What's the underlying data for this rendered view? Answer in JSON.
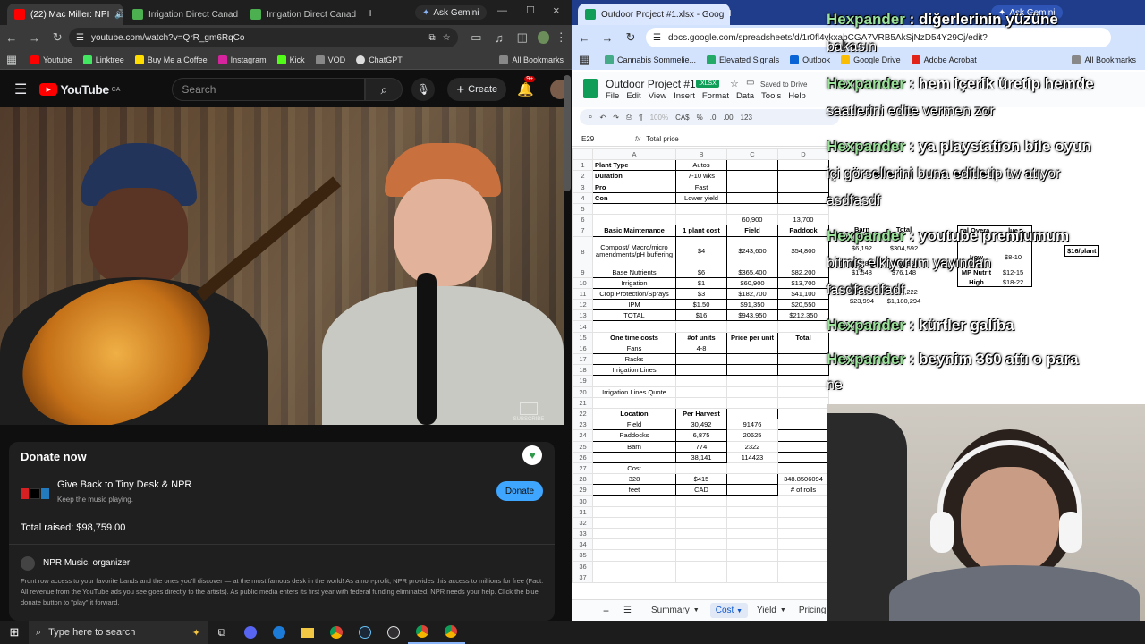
{
  "left_browser": {
    "tabs": [
      {
        "label": "(22) Mac Miller: NPI",
        "active": true
      },
      {
        "label": "Irrigation Direct Canad"
      },
      {
        "label": "Irrigation Direct Canad"
      }
    ],
    "new_tab": "+",
    "ask_gemini": "Ask Gemini",
    "url": "youtube.com/watch?v=QrR_gm6RqCo",
    "bookmarks": [
      "Youtube",
      "Linktree",
      "Buy Me a Coffee",
      "Instagram",
      "Kick",
      "VOD",
      "ChatGPT"
    ],
    "all_bookmarks": "All Bookmarks"
  },
  "youtube": {
    "logo": "YouTube",
    "country": "CA",
    "search_placeholder": "Search",
    "create": "Create",
    "notif_badge": "9+",
    "subscribe_watermark": "SUBSCRIBE",
    "donate": {
      "title": "Donate now",
      "give_back": "Give Back to Tiny Desk & NPR",
      "keep": "Keep the music playing.",
      "donate_btn": "Donate",
      "total": "Total raised: $98,759.00",
      "organizer": "NPR Music, organizer",
      "npr_logo": "n p r",
      "desc": "Front row access to your favorite bands and the ones you'll discover — at the most famous desk in the world! As a non-profit, NPR provides this access to millions for free (Fact: All revenue from the YouTube ads you see goes directly to the artists). As public media enters its first year with federal funding eliminated, NPR needs your help. Click the blue donate button to \"play\" it forward."
    }
  },
  "right_browser": {
    "tab": "Outdoor Project #1.xlsx - Goog",
    "ask_gemini": "Ask Gemini",
    "url": "docs.google.com/spreadsheets/d/1r0fl4vkxabCGA7VRB5AkSjNzD54Y29Cj/edit?",
    "bookmarks": [
      "Cannabis Sommelie...",
      "Elevated Signals",
      "Outlook",
      "Google Drive",
      "Adobe Acrobat"
    ],
    "all_bookmarks": "All Bookmarks"
  },
  "sheets": {
    "title": "Outdoor Project #1",
    "badge": ".XLSX",
    "saved": "Saved to Drive",
    "menu": [
      "File",
      "Edit",
      "View",
      "Insert",
      "Format",
      "Data",
      "Tools",
      "Help"
    ],
    "zoom": "100%",
    "currency": "CA$",
    "percent": "%",
    "dec1": ".0",
    "dec2": ".00",
    "num": "123",
    "cell_ref": "E29",
    "formula": "Total price",
    "columns": [
      "A",
      "B",
      "C",
      "D"
    ],
    "rows": [
      {
        "n": "1",
        "a": "Plant Type",
        "b": "Autos",
        "c": "",
        "d": ""
      },
      {
        "n": "2",
        "a": "Duration",
        "b": "7-10 wks",
        "c": "",
        "d": ""
      },
      {
        "n": "3",
        "a": "Pro",
        "b": "Fast",
        "c": "",
        "d": ""
      },
      {
        "n": "4",
        "a": "Con",
        "b": "Lower yield",
        "c": "",
        "d": ""
      },
      {
        "n": "5",
        "a": "",
        "b": "",
        "c": "",
        "d": ""
      },
      {
        "n": "6",
        "a": "",
        "b": "",
        "c": "60,900",
        "d": "13,700"
      },
      {
        "n": "7",
        "a": "Basic Maintenance",
        "b": "1 plant cost",
        "c": "Field",
        "d": "Paddock"
      },
      {
        "n": "8",
        "a": "Compost/ Macro/micro amendments/pH buffering",
        "b": "$4",
        "c": "$243,600",
        "d": "$54,800"
      },
      {
        "n": "9",
        "a": "Base Nutrients",
        "b": "$6",
        "c": "$365,400",
        "d": "$82,200"
      },
      {
        "n": "10",
        "a": "Irrigation",
        "b": "$1",
        "c": "$60,900",
        "d": "$13,700"
      },
      {
        "n": "11",
        "a": "Crop Protection/Sprays",
        "b": "$3",
        "c": "$182,700",
        "d": "$41,100"
      },
      {
        "n": "12",
        "a": "IPM",
        "b": "$1.50",
        "c": "$91,350",
        "d": "$20,550"
      },
      {
        "n": "13",
        "a": "TOTAL",
        "b": "$16",
        "c": "$943,950",
        "d": "$212,350"
      },
      {
        "n": "14",
        "a": "",
        "b": "",
        "c": "",
        "d": ""
      },
      {
        "n": "15",
        "a": "One time costs",
        "b": "#of units",
        "c": "Price per unit",
        "d": "Total"
      },
      {
        "n": "16",
        "a": "Fans",
        "b": "4-8",
        "c": "",
        "d": ""
      },
      {
        "n": "17",
        "a": "Racks",
        "b": "",
        "c": "",
        "d": ""
      },
      {
        "n": "18",
        "a": "Irrigation Lines",
        "b": "",
        "c": "",
        "d": ""
      },
      {
        "n": "19",
        "a": "",
        "b": "",
        "c": "",
        "d": ""
      },
      {
        "n": "20",
        "a": "Irrigation Lines Quote",
        "b": "",
        "c": "",
        "d": ""
      },
      {
        "n": "21",
        "a": "",
        "b": "",
        "c": "",
        "d": ""
      },
      {
        "n": "22",
        "a": "Location",
        "b": "Per Harvest",
        "c": "",
        "d": ""
      },
      {
        "n": "23",
        "a": "Field",
        "b": "30,492",
        "c": "91476",
        "d": ""
      },
      {
        "n": "24",
        "a": "Paddocks",
        "b": "6,875",
        "c": "20625",
        "d": ""
      },
      {
        "n": "25",
        "a": "Barn",
        "b": "774",
        "c": "2322",
        "d": ""
      },
      {
        "n": "26",
        "a": "",
        "b": "38,141",
        "c": "114423",
        "d": ""
      },
      {
        "n": "27",
        "a": "Cost",
        "b": "",
        "c": "",
        "d": ""
      },
      {
        "n": "28",
        "a": "328",
        "b": "$415",
        "c": "",
        "d": "348.8506094"
      },
      {
        "n": "29",
        "a": "feet",
        "b": "CAD",
        "c": "",
        "d": "# of rolls"
      },
      {
        "n": "30",
        "a": "",
        "b": "",
        "c": "",
        "d": ""
      },
      {
        "n": "31",
        "a": "",
        "b": "",
        "c": "",
        "d": ""
      },
      {
        "n": "32",
        "a": "",
        "b": "",
        "c": "",
        "d": ""
      },
      {
        "n": "33",
        "a": "",
        "b": "",
        "c": "",
        "d": ""
      },
      {
        "n": "34",
        "a": "",
        "b": "",
        "c": "",
        "d": ""
      },
      {
        "n": "35",
        "a": "",
        "b": "",
        "c": "",
        "d": ""
      },
      {
        "n": "36",
        "a": "",
        "b": "",
        "c": "",
        "d": ""
      },
      {
        "n": "37",
        "a": "",
        "b": "",
        "c": "",
        "d": ""
      }
    ],
    "partial_cols": {
      "e_header": "Barn",
      "f_header": "Total",
      "e_vals": [
        "$6,192",
        "$8,288",
        "$1,548",
        "$2,322",
        "$23,994"
      ],
      "f_vals": [
        "$304,592",
        "$456,880",
        "$76,148",
        "$114,222",
        "$1,180,294"
      ],
      "tier_header": "al Overa",
      "cost_header": "lue Cost/per",
      "tiers": [
        {
          "t": "Low",
          "v": "$8-10"
        },
        {
          "t": "MP Nutrit",
          "v": "$12-15"
        },
        {
          "t": "High",
          "v": "$18-22"
        }
      ],
      "per_plant": "$16/plant"
    },
    "sheet_tabs": [
      "Summary",
      "Cost",
      "Yield",
      "Pricing"
    ],
    "active_tab": "Cost"
  },
  "chat": [
    {
      "user": "Hexpander",
      "text": ": diğerlerinin yüzüne"
    },
    {
      "user": "",
      "text": "bakasın"
    },
    {
      "user": "Hexpander",
      "text": ": hem içerik üretip hemde"
    },
    {
      "user": "",
      "text": "saatlerini edite vermen zor"
    },
    {
      "user": "Hexpander",
      "text": ": ya playstation bile oyun"
    },
    {
      "user": "",
      "text": "içi görsellerini buna editletip tw atıyor"
    },
    {
      "user": "",
      "text": "asdfasdf"
    },
    {
      "user": "Hexpander",
      "text": ": youtube premiumum"
    },
    {
      "user": "",
      "text": "bitmiş elkiyorum yayından"
    },
    {
      "user": "",
      "text": "fasdfasdfadf"
    },
    {
      "user": "Hexpander",
      "text": ": kürtler galiba"
    },
    {
      "user": "Hexpander",
      "text": ": beynim 360 attı o para"
    },
    {
      "user": "",
      "text": "ne"
    }
  ],
  "taskbar": {
    "search_placeholder": "Type here to search"
  },
  "colors": {
    "yt_red": "#ff0000",
    "donate_blue": "#3ea6ff",
    "sheets_green": "#0f9d58",
    "chat_name": "#9be39b"
  }
}
